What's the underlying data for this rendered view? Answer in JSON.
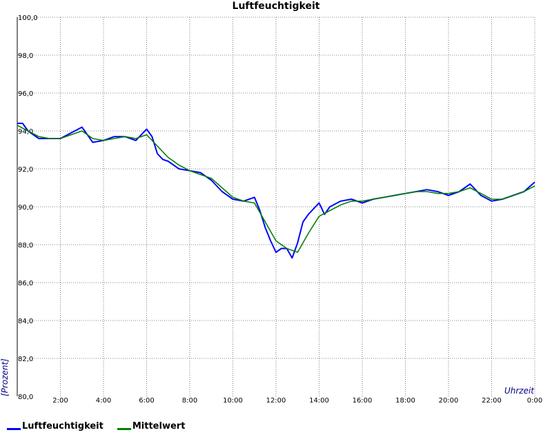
{
  "chart_data": {
    "type": "line",
    "title": "Luftfeuchtigkeit",
    "xlabel": "Uhrzeit",
    "ylabel": "[Prozent]",
    "xlim": [
      0,
      24
    ],
    "ylim": [
      80,
      100
    ],
    "grid": true,
    "y_ticks": [
      {
        "value": 80,
        "label": "80,0"
      },
      {
        "value": 82,
        "label": "82,0"
      },
      {
        "value": 84,
        "label": "84,0"
      },
      {
        "value": 86,
        "label": "86,0"
      },
      {
        "value": 88,
        "label": "88,0"
      },
      {
        "value": 90,
        "label": "90,0"
      },
      {
        "value": 92,
        "label": "92,0"
      },
      {
        "value": 94,
        "label": "94,0"
      },
      {
        "value": 96,
        "label": "96,0"
      },
      {
        "value": 98,
        "label": "98,0"
      },
      {
        "value": 100,
        "label": "100,0"
      }
    ],
    "x_ticks": [
      {
        "value": 2,
        "label": "2:00"
      },
      {
        "value": 4,
        "label": "4:00"
      },
      {
        "value": 6,
        "label": "6:00"
      },
      {
        "value": 8,
        "label": "8:00"
      },
      {
        "value": 10,
        "label": "10:00"
      },
      {
        "value": 12,
        "label": "12:00"
      },
      {
        "value": 14,
        "label": "14:00"
      },
      {
        "value": 16,
        "label": "16:00"
      },
      {
        "value": 18,
        "label": "18:00"
      },
      {
        "value": 20,
        "label": "20:00"
      },
      {
        "value": 22,
        "label": "22:00"
      },
      {
        "value": 24,
        "label": "0:00"
      }
    ],
    "legend_position": "bottom-left",
    "series": [
      {
        "name": "Luftfeuchtigkeit",
        "color": "#0000ff",
        "x": [
          0,
          0.25,
          0.5,
          0.75,
          1,
          1.5,
          2,
          2.5,
          3,
          3.25,
          3.5,
          4,
          4.5,
          5,
          5.5,
          6,
          6.25,
          6.5,
          6.75,
          7,
          7.5,
          8,
          8.5,
          9,
          9.5,
          10,
          10.5,
          11,
          11.25,
          11.5,
          11.75,
          12,
          12.25,
          12.5,
          12.75,
          13,
          13.25,
          13.5,
          13.75,
          14,
          14.25,
          14.5,
          15,
          15.5,
          16,
          16.5,
          17,
          17.5,
          18,
          18.5,
          19,
          19.5,
          20,
          20.5,
          21,
          21.25,
          21.5,
          22,
          22.5,
          23,
          23.5,
          24
        ],
        "values": [
          94.4,
          94.4,
          94.0,
          93.8,
          93.6,
          93.6,
          93.6,
          93.9,
          94.2,
          93.8,
          93.4,
          93.5,
          93.7,
          93.7,
          93.5,
          94.1,
          93.7,
          92.8,
          92.5,
          92.4,
          92.0,
          91.9,
          91.8,
          91.4,
          90.8,
          90.4,
          90.3,
          90.5,
          89.8,
          88.9,
          88.2,
          87.6,
          87.8,
          87.8,
          87.3,
          88.1,
          89.2,
          89.6,
          89.9,
          90.2,
          89.6,
          90.0,
          90.3,
          90.4,
          90.2,
          90.4,
          90.5,
          90.6,
          90.7,
          90.8,
          90.9,
          90.8,
          90.6,
          90.8,
          91.2,
          90.9,
          90.6,
          90.3,
          90.4,
          90.6,
          90.8,
          91.3
        ]
      },
      {
        "name": "Mittelwert",
        "color": "#008000",
        "x": [
          0,
          0.5,
          1,
          1.5,
          2,
          2.5,
          3,
          3.5,
          4,
          4.5,
          5,
          5.5,
          6,
          6.5,
          7,
          7.5,
          8,
          8.5,
          9,
          9.5,
          10,
          10.5,
          11,
          11.5,
          12,
          12.5,
          13,
          13.5,
          14,
          14.5,
          15,
          15.5,
          16,
          16.5,
          17,
          17.5,
          18,
          18.5,
          19,
          19.5,
          20,
          20.5,
          21,
          21.5,
          22,
          22.5,
          23,
          23.5,
          24
        ],
        "values": [
          94.3,
          94.0,
          93.7,
          93.6,
          93.6,
          93.8,
          94.0,
          93.6,
          93.5,
          93.6,
          93.7,
          93.6,
          93.8,
          93.2,
          92.6,
          92.2,
          91.9,
          91.7,
          91.5,
          91.0,
          90.5,
          90.3,
          90.2,
          89.2,
          88.2,
          87.8,
          87.6,
          88.6,
          89.5,
          89.8,
          90.1,
          90.3,
          90.3,
          90.4,
          90.5,
          90.6,
          90.7,
          90.8,
          90.8,
          90.7,
          90.7,
          90.8,
          91.0,
          90.7,
          90.4,
          90.4,
          90.6,
          90.8,
          91.1
        ]
      }
    ]
  }
}
